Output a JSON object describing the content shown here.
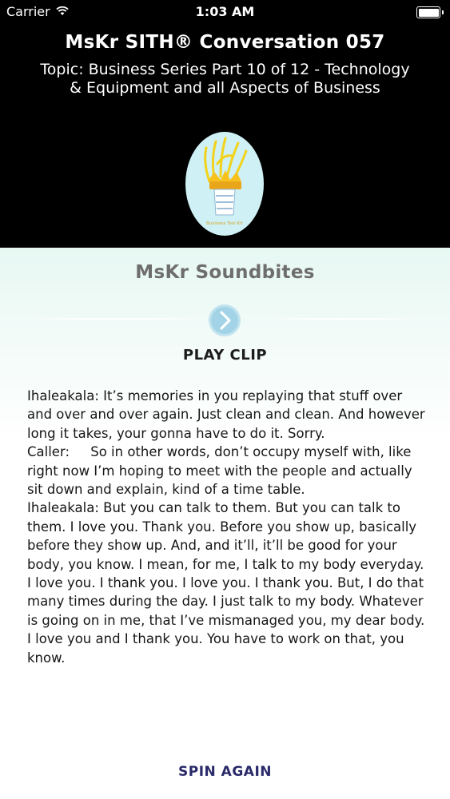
{
  "status_bar": {
    "carrier": "Carrier",
    "time": "1:03 AM",
    "icons": [
      "wifi-icon",
      "battery-icon"
    ]
  },
  "header": {
    "title": "MsKr SITH® Conversation 057",
    "topic": "Topic: Business Series Part 10 of 12 - Technology & Equipment and all Aspects of Business",
    "logo_caption": "Business Tool Kit",
    "logo_icon": "crown-hat-logo-icon"
  },
  "soundbites": {
    "title": "MsKr Soundbites",
    "play_icon": "play-circle-icon",
    "play_label": "PLAY CLIP",
    "transcript": [
      "Ihaleakala: It’s memories in you replaying that stuff over and over and over again. Just clean and clean. And however long it takes, your gonna have to do it. Sorry.",
      "Caller:     So in other words, don’t occupy myself with, like right now I’m hoping to meet with the people and actually sit down and explain, kind of a time table.",
      "Ihaleakala: But you can talk to them. But you can talk to them. I love you. Thank you. Before you show up, basically before they show up. And, and it’ll, it’ll be good for your body, you know. I mean, for me, I talk to my body everyday. I love you. I thank you. I love you. I thank you. But, I do that many times during the day. I just talk to my body. Whatever is going on in me, that I’ve mismanaged you, my dear body. I love you and I thank you. You have to work on that, you know."
    ],
    "spin_label": "SPIN AGAIN"
  },
  "colors": {
    "header_bg": "#000000",
    "content_bg_top": "#e7f8f3",
    "logo_bg": "#cff1f5",
    "spin_text": "#2a2a6a",
    "play_icon": "#a8d8e8"
  }
}
